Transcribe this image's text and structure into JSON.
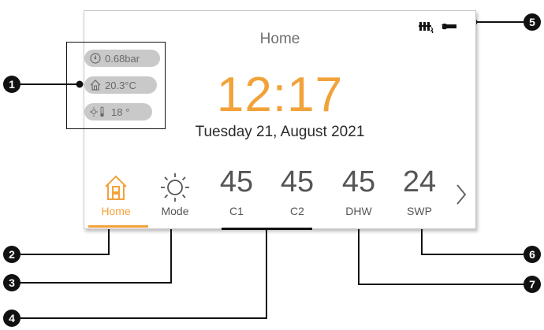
{
  "screen": {
    "title": "Home",
    "clock": "12:17",
    "date": "Tuesday 21, August 2021",
    "accent_color": "#f2a23a"
  },
  "status_icons": [
    "radiator-icon",
    "wrench-icon"
  ],
  "info_pills": [
    {
      "icon": "gauge-icon",
      "text": "0.68bar"
    },
    {
      "icon": "house-icon",
      "text": "20.3°C"
    },
    {
      "icon": "sun-thermometer-icon",
      "text": "18 °"
    }
  ],
  "tiles": [
    {
      "value": "",
      "label": "Home",
      "icon": "home-icon",
      "active": true
    },
    {
      "value": "",
      "label": "Mode",
      "icon": "sun-icon",
      "active": false
    },
    {
      "value": "45",
      "label": "C1"
    },
    {
      "value": "45",
      "label": "C2"
    },
    {
      "value": "45",
      "label": "DHW"
    },
    {
      "value": "24",
      "label": "SWP"
    }
  ],
  "next_icon": "chevron-right-icon",
  "callouts": [
    "1",
    "2",
    "3",
    "4",
    "5",
    "6",
    "7"
  ]
}
